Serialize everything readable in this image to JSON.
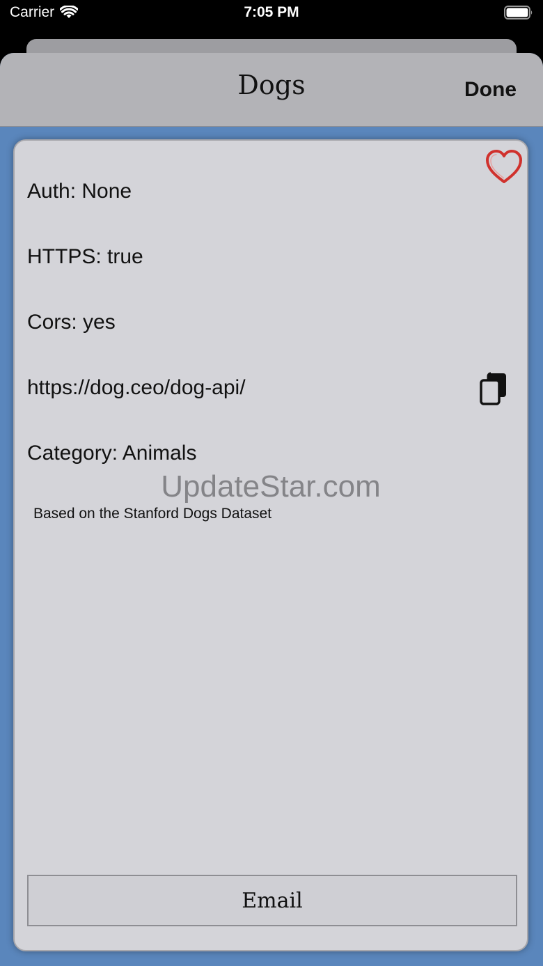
{
  "status_bar": {
    "carrier": "Carrier",
    "time": "7:05 PM"
  },
  "nav": {
    "title": "Dogs",
    "done_label": "Done"
  },
  "detail": {
    "auth": "Auth: None",
    "https": "HTTPS: true",
    "cors": "Cors: yes",
    "url": "https://dog.ceo/dog-api/",
    "category": "Category: Animals",
    "description": "Based on the Stanford Dogs Dataset"
  },
  "watermark": "UpdateStar.com",
  "email_label": "Email",
  "icons": {
    "favorite": "heart-outline-icon",
    "copy": "copy-icon",
    "wifi": "wifi-icon",
    "battery": "battery-icon"
  },
  "colors": {
    "background_blue": "#5a86bc",
    "card": "#d4d4d9",
    "nav_bar": "#b3b3b7",
    "heart": "#d0312d"
  }
}
